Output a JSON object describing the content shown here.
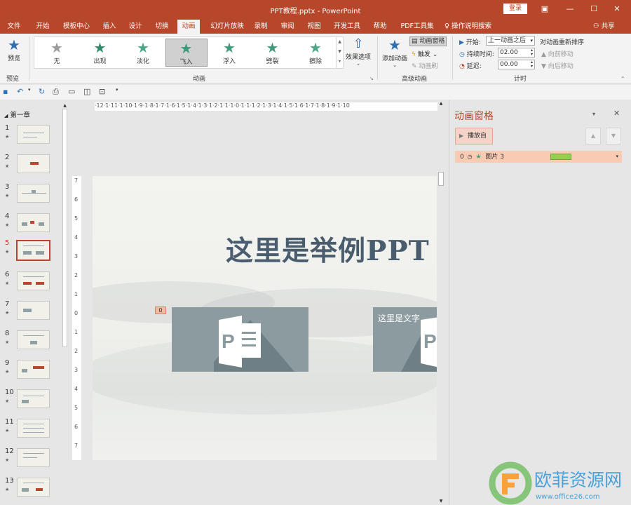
{
  "window": {
    "title": "PPT教程.pptx - PowerPoint",
    "login": "登录"
  },
  "tabs": [
    "文件",
    "开始",
    "模板中心",
    "插入",
    "设计",
    "切换",
    "动画",
    "幻灯片放映",
    "录制",
    "审阅",
    "视图",
    "开发工具",
    "帮助",
    "PDF工具集"
  ],
  "active_tab": "动画",
  "tell_me": "操作说明搜索",
  "share": "共享",
  "ribbon": {
    "preview": {
      "label": "预览",
      "group": "预览"
    },
    "animations": [
      {
        "label": "无",
        "color": "#9a9a9a"
      },
      {
        "label": "出现",
        "color": "#2e8b6a"
      },
      {
        "label": "淡化",
        "color": "#4aa887"
      },
      {
        "label": "飞入",
        "color": "#3e9b7a"
      },
      {
        "label": "浮入",
        "color": "#3e9b7a"
      },
      {
        "label": "劈裂",
        "color": "#3e9b7a"
      },
      {
        "label": "擦除",
        "color": "#4aa887"
      }
    ],
    "selected_animation": "飞入",
    "effect_options": "效果选项",
    "group_animation": "动画",
    "add_animation": "添加动画",
    "animation_pane": "动画窗格",
    "trigger": "触发",
    "animation_painter": "动画刷",
    "group_advanced": "高级动画",
    "start_label": "开始:",
    "start_value": "上一动画之后",
    "duration_label": "持续时间:",
    "duration_value": "02.00",
    "delay_label": "延迟:",
    "delay_value": "00.00",
    "group_timing": "计时",
    "reorder_title": "对动画重新排序",
    "move_earlier": "向前移动",
    "move_later": "向后移动"
  },
  "thumbnails": {
    "section": "第一章",
    "numbers": [
      "1",
      "2",
      "3",
      "4",
      "5",
      "6",
      "7",
      "8",
      "9",
      "10",
      "11",
      "12",
      "13"
    ],
    "selected": "5"
  },
  "hruler": "·12·1·11·1·10·1·9·1·8·1·7·1·6·1·5·1·4·1·3·1·2·1·1·1·0·1·1·1·2·1·3·1·4·1·5·1·6·1·7·1·8·1·9·1·10",
  "vruler": [
    "7",
    "6",
    "5",
    "4",
    "3",
    "2",
    "1",
    "0",
    "1",
    "2",
    "3",
    "4",
    "5",
    "6",
    "7"
  ],
  "slide": {
    "title": "这里是举例PPT",
    "anim_tag": "0",
    "pic_text": "这里是文字"
  },
  "pane": {
    "title": "动画窗格",
    "play": "播放自",
    "item_order": "0",
    "item_name": "图片 3"
  }
}
